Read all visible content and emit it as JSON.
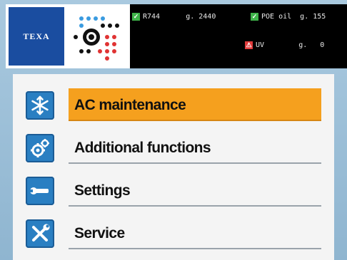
{
  "header": {
    "brand": "TEXA",
    "status_lines": [
      {
        "check": "✓",
        "text": "R744      g. 2440"
      },
      {
        "check": "✓",
        "text": "POE oil  g. 155"
      },
      {
        "warn": "⚠",
        "text": "UV        g.   0"
      }
    ]
  },
  "menu": {
    "items": [
      {
        "label": "AC maintenance",
        "icon": "snowflake-icon",
        "selected": true
      },
      {
        "label": "Additional functions",
        "icon": "gears-icon",
        "selected": false
      },
      {
        "label": "Settings",
        "icon": "wrench-icon",
        "selected": false
      },
      {
        "label": "Service",
        "icon": "tools-icon",
        "selected": false
      }
    ]
  },
  "colors": {
    "accent": "#f5a01e",
    "icon_bg": "#2a7fc2",
    "header_bg": "#000000",
    "brand_bg": "#1a4da0"
  }
}
